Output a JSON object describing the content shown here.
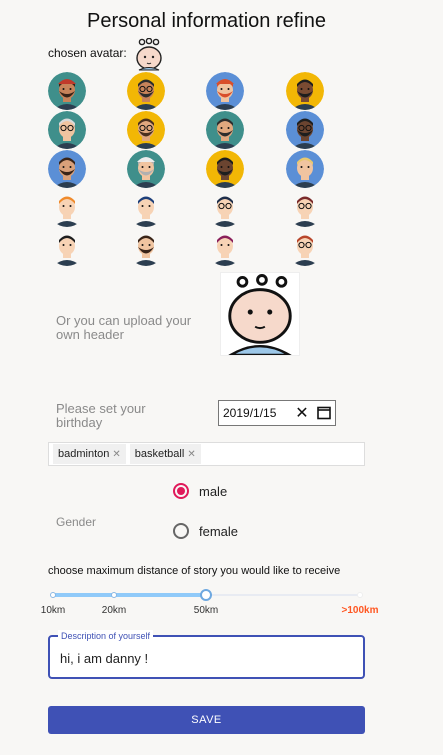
{
  "title": "Personal information refine",
  "chosen_avatar_label": "chosen avatar:",
  "avatars": [
    {
      "icon": "avatar-bearded-man-icon",
      "bg": "#3f8f8b",
      "skin": "#c8835a",
      "hair": "#3a2418",
      "beard": true,
      "glasses": false,
      "hat": "#c0392b"
    },
    {
      "icon": "avatar-sunglasses-man-icon",
      "bg": "#f2b705",
      "skin": "#c8835a",
      "hair": "#2d2d2d",
      "beard": true,
      "glasses": true,
      "hat": ""
    },
    {
      "icon": "avatar-cap-man-icon",
      "bg": "#5b8fd6",
      "skin": "#f0c4a0",
      "hair": "#d94f2b",
      "beard": true,
      "glasses": false,
      "hat": "#d94f2b"
    },
    {
      "icon": "avatar-red-shirt-man-icon",
      "bg": "#f2b705",
      "skin": "#7a4b32",
      "hair": "#1e1e1e",
      "beard": true,
      "glasses": false,
      "hat": ""
    },
    {
      "icon": "avatar-old-woman-icon",
      "bg": "#3f8f8b",
      "skin": "#f0c4a0",
      "hair": "#d9d9d9",
      "beard": false,
      "glasses": true,
      "hat": ""
    },
    {
      "icon": "avatar-glasses-man-icon",
      "bg": "#f2b705",
      "skin": "#e0a77e",
      "hair": "#4a3020",
      "beard": true,
      "glasses": true,
      "hat": ""
    },
    {
      "icon": "avatar-hipster-man-icon",
      "bg": "#3f8f8b",
      "skin": "#e0a77e",
      "hair": "#2d2d2d",
      "beard": true,
      "glasses": false,
      "hat": ""
    },
    {
      "icon": "avatar-dark-man-icon",
      "bg": "#5b8fd6",
      "skin": "#6b4430",
      "hair": "#1e1e1e",
      "beard": true,
      "glasses": true,
      "hat": ""
    },
    {
      "icon": "avatar-cool-man-icon",
      "bg": "#5b8fd6",
      "skin": "#d9a07a",
      "hair": "#3a2418",
      "beard": true,
      "glasses": false,
      "hat": ""
    },
    {
      "icon": "avatar-fedora-man-icon",
      "bg": "#3f8f8b",
      "skin": "#f0c4a0",
      "hair": "#b0b0b0",
      "beard": true,
      "glasses": false,
      "hat": "#ececec"
    },
    {
      "icon": "avatar-afro-man-icon",
      "bg": "#f2b705",
      "skin": "#6b4430",
      "hair": "#1e1e1e",
      "beard": true,
      "glasses": false,
      "hat": ""
    },
    {
      "icon": "avatar-blond-man-icon",
      "bg": "#5b8fd6",
      "skin": "#f0c4a0",
      "hair": "#e8c870",
      "beard": false,
      "glasses": false,
      "hat": ""
    },
    {
      "icon": "avatar-girl-orange-icon",
      "bg": "#f8f7f5",
      "skin": "#f7d3b5",
      "hair": "#f08a2a",
      "beard": false,
      "glasses": false,
      "hat": ""
    },
    {
      "icon": "avatar-girl-blue-icon",
      "bg": "#f8f7f5",
      "skin": "#f7d3b5",
      "hair": "#1d3f7a",
      "beard": false,
      "glasses": false,
      "hat": ""
    },
    {
      "icon": "avatar-boy-glasses-icon",
      "bg": "#f8f7f5",
      "skin": "#f7d3b5",
      "hair": "#1e2e4a",
      "beard": false,
      "glasses": true,
      "hat": ""
    },
    {
      "icon": "avatar-girl-brown-icon",
      "bg": "#f8f7f5",
      "skin": "#f7d3b5",
      "hair": "#7a2a2a",
      "beard": false,
      "glasses": true,
      "hat": ""
    },
    {
      "icon": "avatar-boy-phone-icon",
      "bg": "#f8f7f5",
      "skin": "#f7d3b5",
      "hair": "#1e1e1e",
      "beard": false,
      "glasses": false,
      "hat": ""
    },
    {
      "icon": "avatar-man-suit-icon",
      "bg": "#f8f7f5",
      "skin": "#f0c4a0",
      "hair": "#3a2418",
      "beard": true,
      "glasses": false,
      "hat": ""
    },
    {
      "icon": "avatar-girl-purple-icon",
      "bg": "#f8f7f5",
      "skin": "#f7d3b5",
      "hair": "#8a1f5a",
      "beard": false,
      "glasses": false,
      "hat": ""
    },
    {
      "icon": "avatar-girl-red-icon",
      "bg": "#f8f7f5",
      "skin": "#f7d3b5",
      "hair": "#b8452a",
      "beard": false,
      "glasses": true,
      "hat": ""
    }
  ],
  "upload_label": "Or you can upload your own header",
  "birthday": {
    "label": "Please set your birthday",
    "value": "2019/1/15"
  },
  "tags": [
    "badminton",
    "basketball"
  ],
  "gender": {
    "label": "Gender",
    "options": [
      "male",
      "female"
    ],
    "selected": "male"
  },
  "distance": {
    "label": "choose maximum distance of story you would like to receive",
    "marks": [
      "10km",
      "20km",
      "50km",
      ">100km"
    ],
    "selected": "50km",
    "highlight_color": "#ff5722"
  },
  "description": {
    "label": "Description of yourself",
    "value": "hi, i am danny !"
  },
  "save_label": "SAVE",
  "colors": {
    "accent": "#3f51b5",
    "radio": "#e0195a",
    "slider": "#90caf9"
  }
}
